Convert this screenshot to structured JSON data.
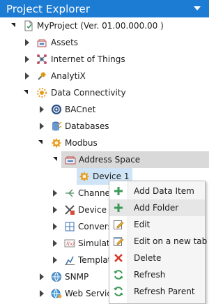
{
  "window": {
    "title": "Project Explorer"
  },
  "tree": {
    "project": "MyProject (Ver. 01.00.000.00 )",
    "assets": "Assets",
    "iot": "Internet of Things",
    "analytix": "AnalytiX",
    "data_connectivity": "Data Connectivity",
    "bacnet": "BACnet",
    "databases": "Databases",
    "modbus": "Modbus",
    "address_space": "Address Space",
    "device1": "Device 1",
    "channels": "Channel",
    "device_templates": "Device T",
    "conversions": "Convers",
    "simulator": "Simulate",
    "templates": "Templat",
    "snmp": "SNMP",
    "web_services": "Web Service"
  },
  "context_menu": {
    "items": [
      {
        "label": "Add Data Item",
        "icon": "plus-icon"
      },
      {
        "label": "Add Folder",
        "icon": "plus-icon"
      },
      {
        "label": "Edit",
        "icon": "edit-icon"
      },
      {
        "label": "Edit on a new tab",
        "icon": "edit-new-tab-icon"
      },
      {
        "label": "Delete",
        "icon": "delete-icon"
      },
      {
        "label": "Refresh",
        "icon": "refresh-icon"
      },
      {
        "label": "Refresh Parent",
        "icon": "refresh-parent-icon"
      }
    ],
    "highlighted_index": 1
  },
  "colors": {
    "title_bar": "#1c7cd3",
    "menu_hover": "#e6e6e6",
    "selected_row": "#d9d9d9"
  }
}
